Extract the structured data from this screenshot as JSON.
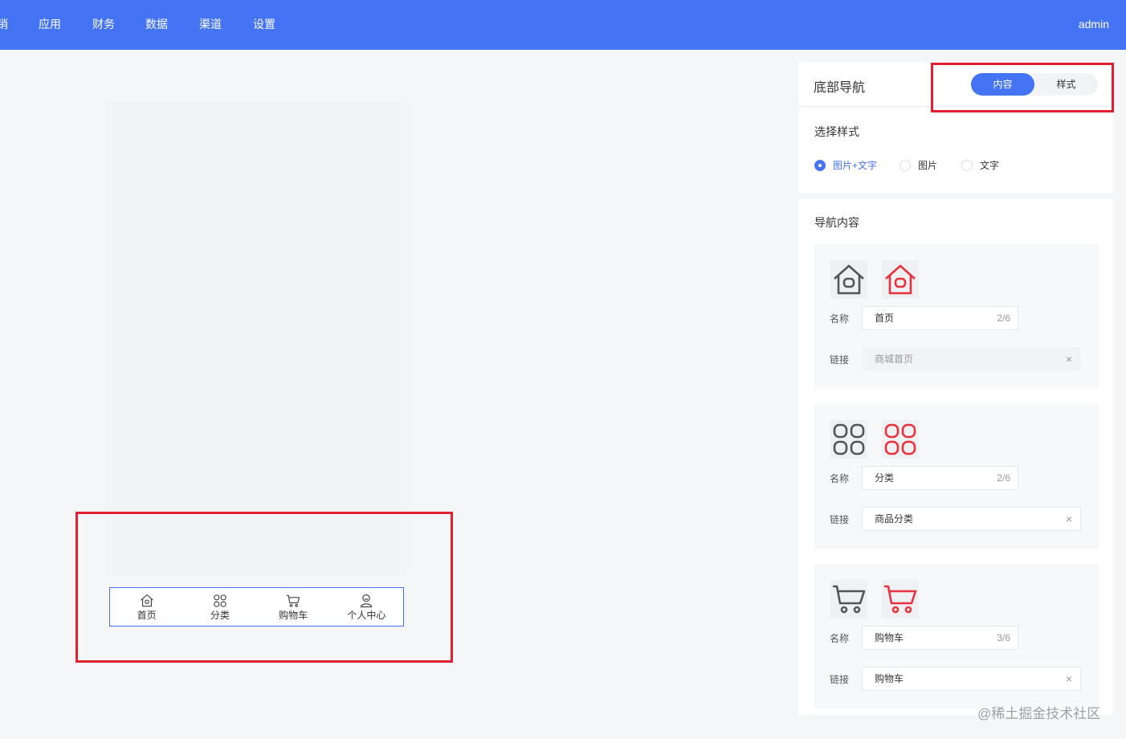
{
  "topbar": {
    "menu": [
      "销",
      "应用",
      "财务",
      "数据",
      "渠道",
      "设置"
    ],
    "user": "admin",
    "bg": "#4474f4"
  },
  "preview": {
    "tabs": [
      {
        "label": "首页",
        "icon": "home-icon"
      },
      {
        "label": "分类",
        "icon": "grid-icon"
      },
      {
        "label": "购物车",
        "icon": "cart-icon"
      },
      {
        "label": "个人中心",
        "icon": "user-icon"
      }
    ]
  },
  "panel": {
    "title": "底部导航",
    "segments": [
      "内容",
      "样式"
    ],
    "active_segment": "内容",
    "style_label": "选择样式",
    "style_options": [
      "图片+文字",
      "图片",
      "文字"
    ],
    "style_selected": "图片+文字",
    "nav_label": "导航内容",
    "items": [
      {
        "name_label": "名称",
        "name": "首页",
        "count": "2/6",
        "link_label": "链接",
        "link": "",
        "link_placeholder": "商城首页",
        "icon": "home-icon"
      },
      {
        "name_label": "名称",
        "name": "分类",
        "count": "2/6",
        "link_label": "链接",
        "link": "商品分类",
        "link_placeholder": "",
        "icon": "grid-icon"
      },
      {
        "name_label": "名称",
        "name": "购物车",
        "count": "3/6",
        "link_label": "链接",
        "link": "购物车",
        "link_placeholder": "",
        "icon": "cart-icon"
      }
    ],
    "clear_glyph": "×",
    "icon_colors": {
      "normal": "#555555",
      "active": "#e8323c"
    }
  },
  "watermark": "@稀土掘金技术社区"
}
